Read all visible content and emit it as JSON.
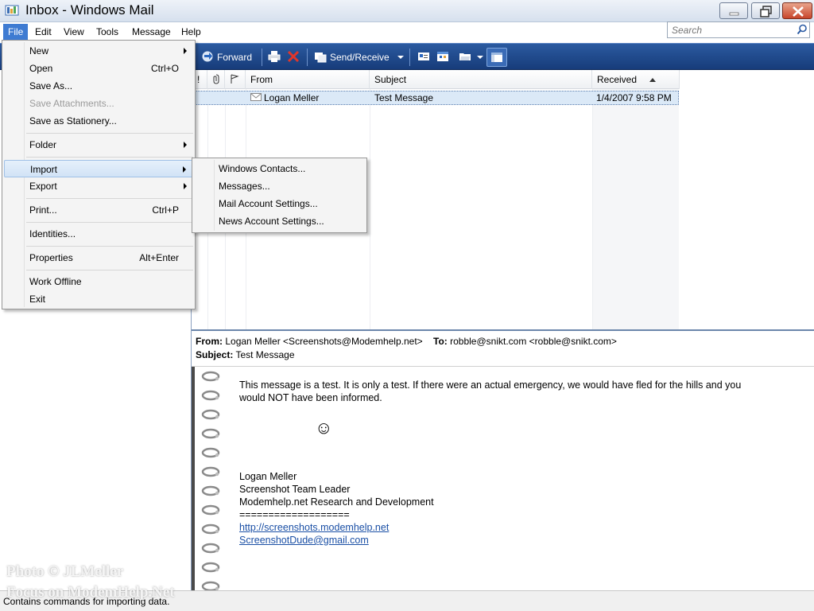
{
  "window": {
    "title": "Inbox - Windows Mail"
  },
  "menubar": {
    "items": [
      "File",
      "Edit",
      "View",
      "Tools",
      "Message",
      "Help"
    ],
    "active": "File"
  },
  "search": {
    "placeholder": "Search"
  },
  "toolbar": {
    "forward_label": "Forward",
    "send_receive_label": "Send/Receive"
  },
  "message_list": {
    "columns": [
      "!",
      "From",
      "Subject",
      "Received"
    ],
    "sort_indicator": "ascending",
    "rows": [
      {
        "from": "Logan Meller",
        "subject": "Test Message",
        "received": "1/4/2007 9:58 PM"
      }
    ]
  },
  "file_menu": {
    "items": [
      {
        "label": "New",
        "shortcut": "",
        "submenu": true,
        "disabled": false
      },
      {
        "label": "Open",
        "shortcut": "Ctrl+O",
        "submenu": false,
        "disabled": false
      },
      {
        "label": "Save As...",
        "shortcut": "",
        "submenu": false,
        "disabled": false
      },
      {
        "label": "Save Attachments...",
        "shortcut": "",
        "submenu": false,
        "disabled": true
      },
      {
        "label": "Save as Stationery...",
        "shortcut": "",
        "submenu": false,
        "disabled": false
      },
      {
        "label": "Folder",
        "shortcut": "",
        "submenu": true,
        "disabled": false
      },
      {
        "label": "Import",
        "shortcut": "",
        "submenu": true,
        "disabled": false,
        "highlighted": true
      },
      {
        "label": "Export",
        "shortcut": "",
        "submenu": true,
        "disabled": false
      },
      {
        "label": "Print...",
        "shortcut": "Ctrl+P",
        "submenu": false,
        "disabled": false
      },
      {
        "label": "Identities...",
        "shortcut": "",
        "submenu": false,
        "disabled": false
      },
      {
        "label": "Properties",
        "shortcut": "Alt+Enter",
        "submenu": false,
        "disabled": false
      },
      {
        "label": "Work Offline",
        "shortcut": "",
        "submenu": false,
        "disabled": false
      },
      {
        "label": "Exit",
        "shortcut": "",
        "submenu": false,
        "disabled": false
      }
    ]
  },
  "import_submenu": {
    "items": [
      "Windows Contacts...",
      "Messages...",
      "Mail Account Settings...",
      "News Account Settings..."
    ]
  },
  "preview": {
    "from_label": "From:",
    "from_value": "Logan Meller <Screenshots@Modemhelp.net>",
    "to_label": "To:",
    "to_value": "robble@snikt.com <robble@snikt.com>",
    "subject_label": "Subject:",
    "subject_value": "Test Message",
    "body_line1": "This message is a test.  It is only a test.  If there were an actual emergency, we would have fled for the hills and you",
    "body_line2": "would NOT have been informed.",
    "smiley": "☺",
    "signature": {
      "name": "Logan Meller",
      "role": "Screenshot Team Leader",
      "org": "Modemhelp.net Research and Development",
      "rule": "===================",
      "link1": "http://screenshots.modemhelp.net",
      "link2": "ScreenshotDude@gmail.com"
    }
  },
  "statusbar": {
    "text": "Contains commands for importing data."
  },
  "watermark": {
    "line1": "Photo © JLMeller",
    "line2": "Focus on ModemHelp.Net"
  },
  "colors": {
    "toolbar_top": "#2b5aa0",
    "toolbar_bottom": "#173c7a",
    "menu_active": "#3e7bd2",
    "selection": "#dbe9f7",
    "link": "#1a4fa5",
    "close_button": "#c8462b"
  },
  "icons": [
    "app-mail-icon",
    "minimize-icon",
    "restore-icon",
    "close-icon",
    "search-icon",
    "forward-icon",
    "print-icon",
    "delete-icon",
    "send-receive-icon",
    "contacts-icon",
    "calendar-icon",
    "folder-icon",
    "layout-icon",
    "importance-icon",
    "attachment-icon",
    "flag-icon",
    "envelope-icon",
    "sort-ascending-icon",
    "spiral-binding-icon"
  ]
}
